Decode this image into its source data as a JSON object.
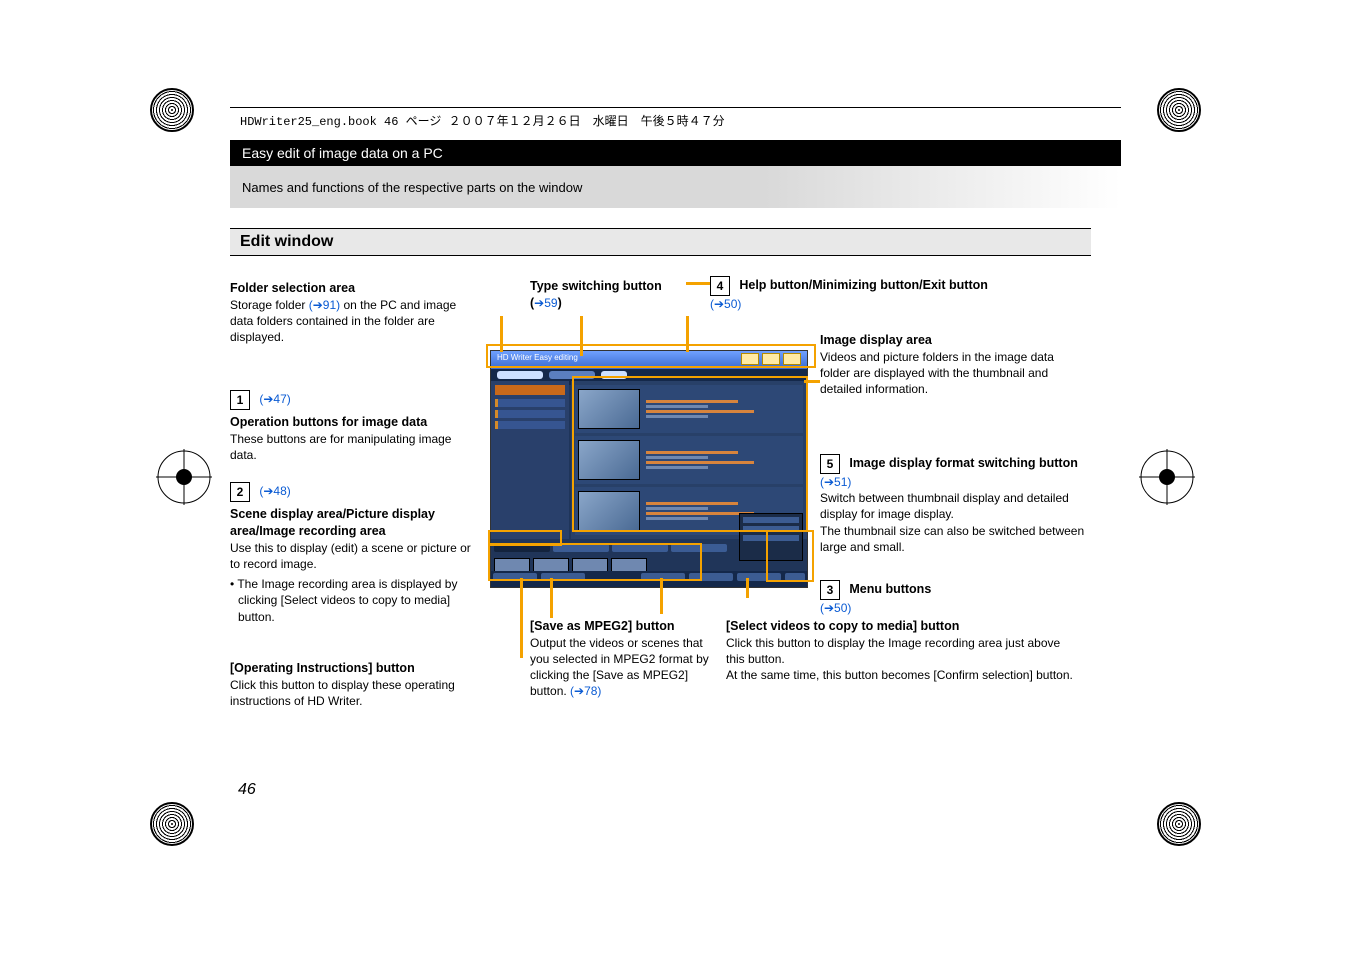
{
  "print_header": "HDWriter25_eng.book  46 ページ  ２００７年１２月２６日　水曜日　午後５時４７分",
  "page_number": "46",
  "band_title": "Easy edit of image data on a PC",
  "sub_band": "Names and functions of the respective parts on the window",
  "section_title": "Edit window",
  "app_title": "HD Writer   Easy editing",
  "type_switch": {
    "heading": "Type switching button",
    "link_prefix": "(",
    "arrow": "➔",
    "ref": "59",
    "link_suffix": ")"
  },
  "folder": {
    "heading": "Folder selection area",
    "text_pre": "Storage folder ",
    "link": "(➔91)",
    "text_post": " on the PC and image data folders contained in the folder are displayed."
  },
  "num1": {
    "n": "1",
    "link": "(➔47)",
    "heading": "Operation buttons for image data",
    "body": "These buttons are for manipulating image data."
  },
  "num2": {
    "n": "2",
    "link": "(➔48)",
    "heading": "Scene display area/Picture display area/Image recording area",
    "body": "Use this to display (edit) a scene or picture or to record image.",
    "bullet": "The Image recording area is displayed by clicking [Select videos to copy to media] button."
  },
  "opinstr": {
    "heading": "[Operating Instructions] button",
    "body": "Click this button to display these operating instructions of HD Writer."
  },
  "save_mpeg2": {
    "heading": "[Save as MPEG2] button",
    "body_pre": "Output the videos or scenes that you selected in MPEG2 format by clicking the [Save as MPEG2] button. ",
    "link": "(➔78)"
  },
  "num3": {
    "n": "3",
    "heading": "Menu buttons",
    "link": "(➔50)"
  },
  "select_copy": {
    "heading": "[Select videos to copy to media] button",
    "body": "Click this button to display the Image recording area just above this button.",
    "body2": "At the same time, this button becomes [Confirm selection] button."
  },
  "num4": {
    "n": "4",
    "heading": "Help button/Minimizing button/Exit button",
    "link": "(➔50)"
  },
  "img_area": {
    "heading": "Image display area",
    "body": "Videos and picture folders in the image data folder are displayed with the thumbnail and detailed information."
  },
  "num5": {
    "n": "5",
    "heading": "Image display format switching button",
    "link": "(➔51)",
    "body1": "Switch between thumbnail display and detailed display for image display.",
    "body2": "The thumbnail size can also be switched between large and small."
  }
}
